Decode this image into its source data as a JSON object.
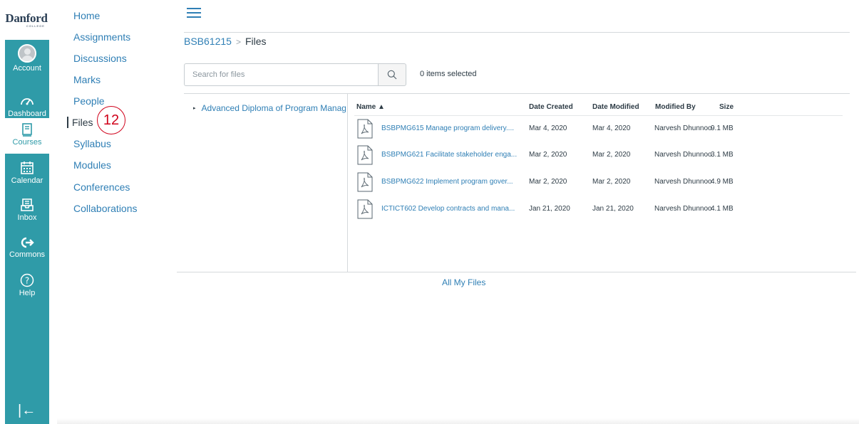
{
  "logo": {
    "name": "Danford",
    "sub": "COLLEGE"
  },
  "global_nav": {
    "items": [
      {
        "label": "Account",
        "icon": "avatar"
      },
      {
        "label": "Dashboard",
        "icon": "dashboard-icon"
      },
      {
        "label": "Courses",
        "icon": "book-icon",
        "active": true
      },
      {
        "label": "Calendar",
        "icon": "calendar-icon"
      },
      {
        "label": "Inbox",
        "icon": "inbox-icon"
      },
      {
        "label": "Commons",
        "icon": "commons-icon"
      },
      {
        "label": "Help",
        "icon": "help-icon"
      }
    ],
    "collapse_glyph": "|←"
  },
  "course_nav": {
    "items": [
      "Home",
      "Assignments",
      "Discussions",
      "Marks",
      "People",
      "Files",
      "Syllabus",
      "Modules",
      "Conferences",
      "Collaborations"
    ],
    "active": "Files"
  },
  "annotation_badge": "12",
  "breadcrumb": {
    "course": "BSB61215",
    "separator": ">",
    "current": "Files"
  },
  "search": {
    "placeholder": "Search for files"
  },
  "selection_status": "0 items selected",
  "folder_tree": {
    "caret": "▸",
    "folder": "Advanced Diploma of Program Management"
  },
  "table": {
    "columns": {
      "name": "Name ▲",
      "created": "Date Created",
      "modified": "Date Modified",
      "modified_by": "Modified By",
      "size": "Size"
    },
    "rows": [
      {
        "name": "BSBPMG615 Manage program delivery....",
        "created": "Mar 4, 2020",
        "modified": "Mar 4, 2020",
        "by": "Narvesh Dhunnoo",
        "size": "9.1 MB"
      },
      {
        "name": "BSBPMG621 Facilitate stakeholder enga...",
        "created": "Mar 2, 2020",
        "modified": "Mar 2, 2020",
        "by": "Narvesh Dhunnoo",
        "size": "3.1 MB"
      },
      {
        "name": "BSBPMG622 Implement program gover...",
        "created": "Mar 2, 2020",
        "modified": "Mar 2, 2020",
        "by": "Narvesh Dhunnoo",
        "size": "4.9 MB"
      },
      {
        "name": "ICTICT602 Develop contracts and mana...",
        "created": "Jan 21, 2020",
        "modified": "Jan 21, 2020",
        "by": "Narvesh Dhunnoo",
        "size": "4.1 MB"
      }
    ]
  },
  "all_files_link": "All My Files",
  "colors": {
    "nav_bg": "#2f9ba8",
    "link": "#2f7fb5",
    "text": "#2d3b45",
    "badge": "#d0021b"
  }
}
